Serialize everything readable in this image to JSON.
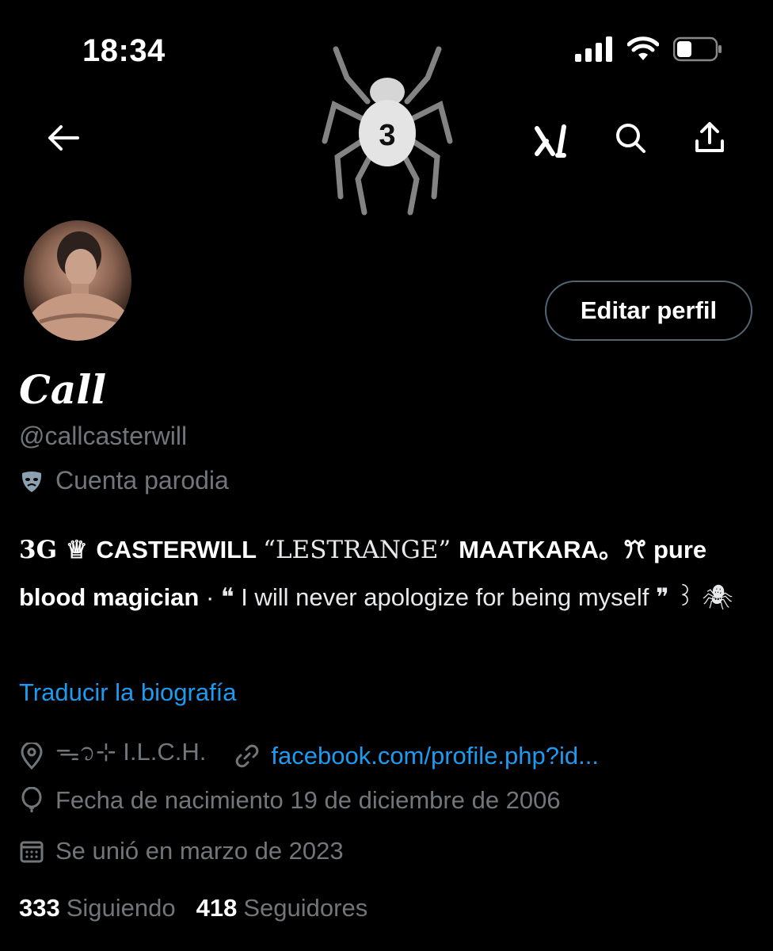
{
  "status_bar": {
    "time": "18:34"
  },
  "profile": {
    "display_name": "Call",
    "handle": "@callcasterwill",
    "parody_label": "Cuenta parodia",
    "edit_button": "Editar perfil",
    "bio": {
      "part1": "3G ♕ ",
      "part2": "CASTERWILL ",
      "part3": "“LESTRANGE” ",
      "part4": "MAATKARA",
      "part5": "。ꔫ pure blood magician",
      "part6": " · ❝ I will never apologize for being myself ❞ ꒱ 🕷"
    },
    "translate_link": "Traducir la biografía",
    "location": "ᯓ᭡⊹ I.L.C.H.",
    "website": "facebook.com/profile.php?id...",
    "birthday": "Fecha de nacimiento 19 de diciembre de 2006",
    "joined": "Se unió en marzo de 2023",
    "following_count": "333",
    "following_label": "Siguiendo",
    "followers_count": "418",
    "followers_label": "Seguidores",
    "emblem_number": "3"
  },
  "icons": [
    "back-arrow-icon",
    "grok-icon",
    "search-icon",
    "share-icon",
    "location-icon",
    "link-icon",
    "balloon-icon",
    "calendar-icon",
    "mask-icon",
    "signal-icon",
    "wifi-icon",
    "battery-icon"
  ],
  "colors": {
    "background": "#000000",
    "accent": "#1d9bf0",
    "muted": "#71767b",
    "text": "#e7e9ea"
  }
}
